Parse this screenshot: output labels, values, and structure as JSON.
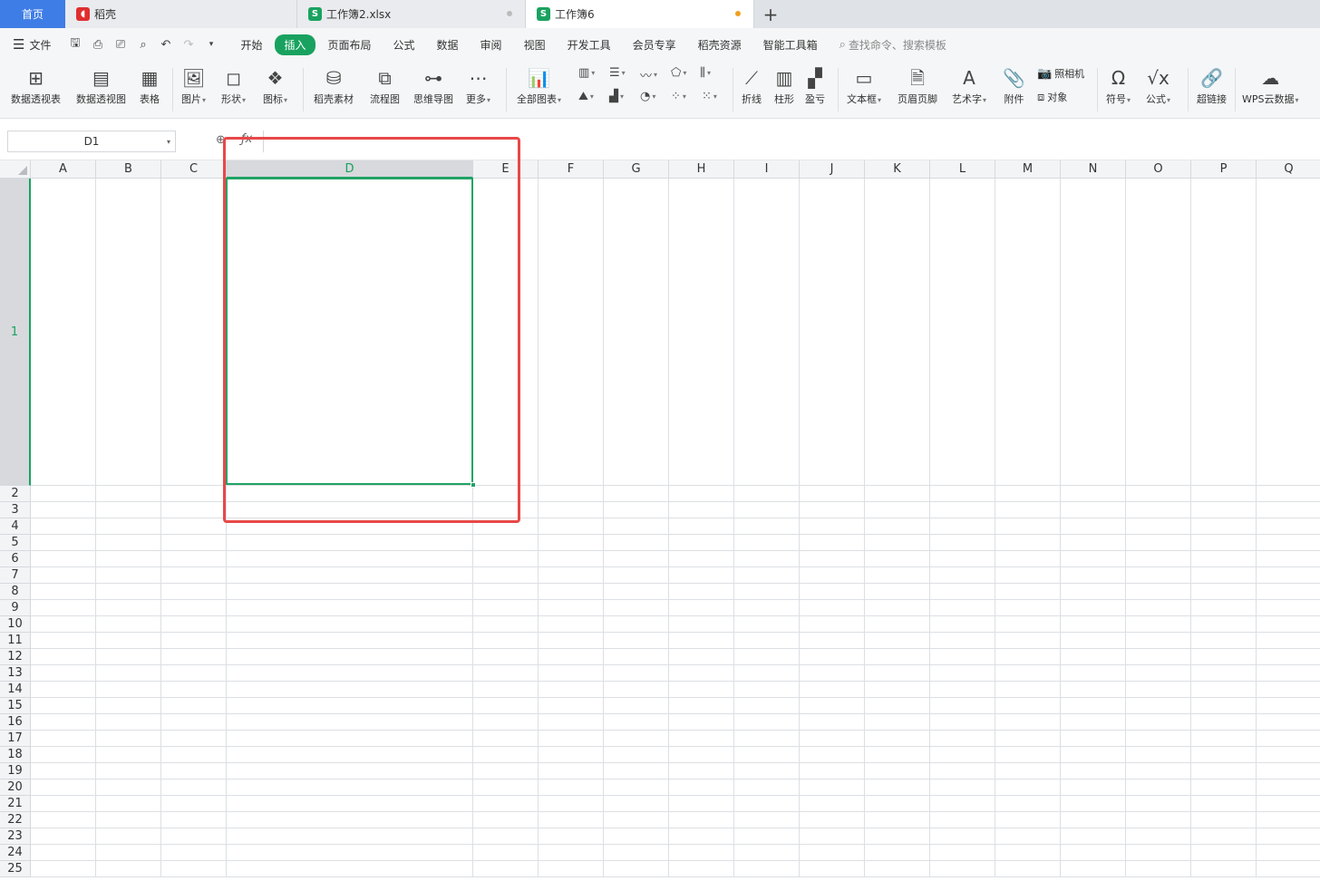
{
  "tabs": {
    "home": "首页",
    "items": [
      {
        "label": "稻壳",
        "icon": "docer-logo-icon",
        "color": "#e02e2e"
      },
      {
        "label": "工作簿2.xlsx",
        "icon": "spreadsheet-icon",
        "color": "#1aa260"
      },
      {
        "label": "工作簿6",
        "icon": "spreadsheet-icon",
        "color": "#1aa260"
      }
    ],
    "add_label": "+"
  },
  "menu": {
    "file_label": "文件",
    "items": [
      "开始",
      "插入",
      "页面布局",
      "公式",
      "数据",
      "审阅",
      "视图",
      "开发工具",
      "会员专享",
      "稻壳资源",
      "智能工具箱"
    ],
    "active_item": "插入",
    "search_placeholder": "查找命令、搜索模板"
  },
  "ribbon": {
    "pivot_table": "数据透视表",
    "pivot_chart": "数据透视图",
    "table": "表格",
    "picture": "图片",
    "shape": "形状",
    "icons": "图标",
    "docer_material": "稻壳素材",
    "flowchart": "流程图",
    "mindmap": "思维导图",
    "more": "更多",
    "all_charts": "全部图表",
    "sparkline_line": "折线",
    "sparkline_column": "柱形",
    "sparkline_winloss": "盈亏",
    "textbox": "文本框",
    "header_footer": "页眉页脚",
    "wordart": "艺术字",
    "attachment": "附件",
    "camera": "照相机",
    "object": "对象",
    "symbol": "符号",
    "equation": "公式",
    "hyperlink": "超链接",
    "wps_cloud_data": "WPS云数据"
  },
  "formula_bar": {
    "cell_ref": "D1",
    "formula": ""
  },
  "grid": {
    "columns": [
      "A",
      "B",
      "C",
      "D",
      "E",
      "F",
      "G",
      "H",
      "I",
      "J",
      "K",
      "L",
      "M",
      "N",
      "O",
      "P",
      "Q"
    ],
    "rows": [
      "1",
      "2",
      "3",
      "4",
      "5",
      "6",
      "7",
      "8",
      "9",
      "10",
      "11",
      "12",
      "13",
      "14",
      "15",
      "16",
      "17",
      "18",
      "19",
      "20",
      "21",
      "22",
      "23",
      "24",
      "25"
    ],
    "selected_column": "D",
    "selected_row": "1",
    "selection_color": "#21a366",
    "highlight_color": "#e84848"
  }
}
